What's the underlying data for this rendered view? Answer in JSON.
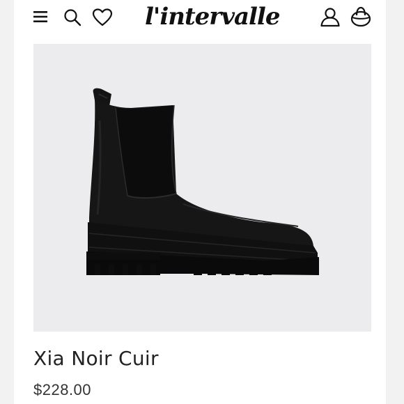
{
  "header": {
    "logo_text": "l'intervalle",
    "icons": [
      "menu-icon",
      "search-icon",
      "wishlist-heart-icon",
      "account-user-icon",
      "cart-bag-icon"
    ]
  },
  "product": {
    "image_alt": "Black leather chelsea boot with lug sole",
    "name": "Xia Noir Cuir",
    "price": "$228.00"
  },
  "colors": {
    "text": "#222222",
    "image_background": "#ececee",
    "boot": "#141414"
  }
}
